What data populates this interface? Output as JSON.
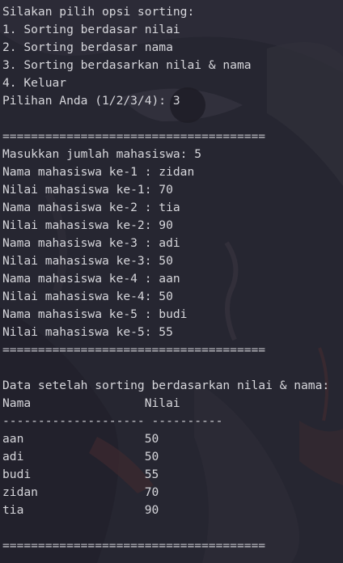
{
  "menu": {
    "title": "Silakan pilih opsi sorting:",
    "options": [
      "1. Sorting berdasar nilai",
      "2. Sorting berdasar nama",
      "3. Sorting berdasarkan nilai & nama",
      "4. Keluar"
    ],
    "prompt": "Pilihan Anda (1/2/3/4): 3"
  },
  "divider": "=====================================",
  "input": {
    "count_prompt": "Masukkan jumlah mahasiswa: 5",
    "entries": [
      "Nama mahasiswa ke-1 : zidan",
      "Nilai mahasiswa ke-1: 70",
      "Nama mahasiswa ke-2 : tia",
      "Nilai mahasiswa ke-2: 90",
      "Nama mahasiswa ke-3 : adi",
      "Nilai mahasiswa ke-3: 50",
      "Nama mahasiswa ke-4 : aan",
      "Nilai mahasiswa ke-4: 50",
      "Nama mahasiswa ke-5 : budi",
      "Nilai mahasiswa ke-5: 55"
    ]
  },
  "result": {
    "title": "Data setelah sorting berdasarkan nilai & nama:",
    "header": "Nama                Nilai",
    "separator": "-------------------- ----------",
    "rows": [
      "aan                 50",
      "adi                 50",
      "budi                55",
      "zidan               70",
      "tia                 90"
    ]
  },
  "colors": {
    "background": "#262631",
    "text": "#d7d7dc"
  }
}
